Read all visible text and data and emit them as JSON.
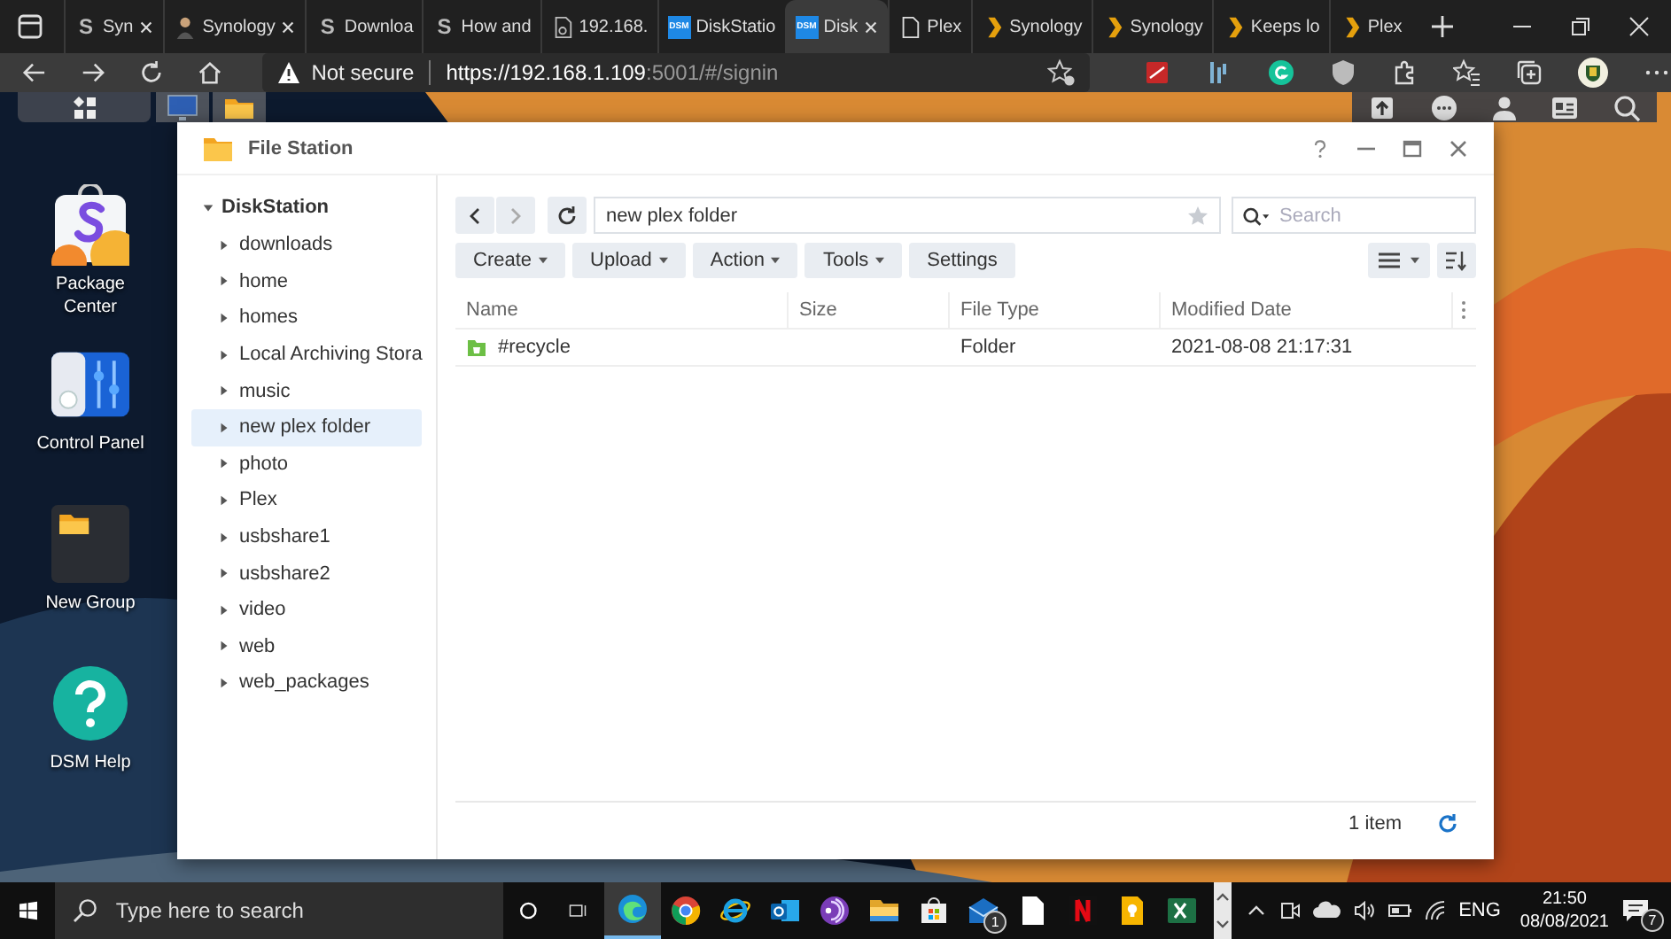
{
  "browser": {
    "tabs": [
      {
        "label": "Syn",
        "kind": "letter",
        "favicon_text": "S",
        "selected": false,
        "closable": true
      },
      {
        "label": "Synology",
        "kind": "person",
        "selected": false,
        "closable": true
      },
      {
        "label": "Downloa",
        "kind": "letter",
        "favicon_text": "S",
        "selected": false,
        "closable": false
      },
      {
        "label": "How and",
        "kind": "letter",
        "favicon_text": "S",
        "selected": false,
        "closable": false
      },
      {
        "label": "192.168.",
        "kind": "pagegear",
        "selected": false,
        "closable": false
      },
      {
        "label": "DiskStatio",
        "kind": "dsm",
        "favicon_text": "DSM",
        "selected": false,
        "closable": false
      },
      {
        "label": "Disk",
        "kind": "dsm",
        "favicon_text": "DSM",
        "selected": true,
        "closable": true
      },
      {
        "label": "Plex",
        "kind": "page",
        "selected": false,
        "closable": false
      },
      {
        "label": "Synology",
        "kind": "chevron",
        "selected": false,
        "closable": false
      },
      {
        "label": "Synology",
        "kind": "chevron",
        "selected": false,
        "closable": false
      },
      {
        "label": "Keeps lo",
        "kind": "chevron",
        "selected": false,
        "closable": false
      },
      {
        "label": "Plex",
        "kind": "chevron",
        "selected": false,
        "closable": false
      }
    ],
    "security": "Not secure",
    "url_main": "https://192.168.1.109",
    "url_rest": ":5001/#/signin"
  },
  "desktop": {
    "shortcuts": [
      {
        "kind": "package",
        "label": "Package Center"
      },
      {
        "kind": "control",
        "label": "Control Panel"
      },
      {
        "kind": "group",
        "label": "New Group"
      },
      {
        "kind": "help",
        "label": "DSM Help"
      }
    ]
  },
  "file_station": {
    "title": "File Station",
    "tree": {
      "label": "DiskStation",
      "expanded": true,
      "children": [
        {
          "label": "downloads",
          "expanded": false,
          "selected": false
        },
        {
          "label": "home",
          "expanded": false,
          "selected": false
        },
        {
          "label": "homes",
          "expanded": false,
          "selected": false
        },
        {
          "label": "Local Archiving Stora",
          "expanded": false,
          "selected": false
        },
        {
          "label": "music",
          "expanded": false,
          "selected": false
        },
        {
          "label": "new plex folder",
          "expanded": false,
          "selected": true
        },
        {
          "label": "photo",
          "expanded": false,
          "selected": false
        },
        {
          "label": "Plex",
          "expanded": false,
          "selected": false
        },
        {
          "label": "usbshare1",
          "expanded": false,
          "selected": false
        },
        {
          "label": "usbshare2",
          "expanded": false,
          "selected": false
        },
        {
          "label": "video",
          "expanded": false,
          "selected": false
        },
        {
          "label": "web",
          "expanded": false,
          "selected": false
        },
        {
          "label": "web_packages",
          "expanded": false,
          "selected": false
        }
      ]
    },
    "path": "new plex folder",
    "search_placeholder": "Search",
    "toolbar": [
      {
        "label": "Create",
        "dropdown": true
      },
      {
        "label": "Upload",
        "dropdown": true
      },
      {
        "label": "Action",
        "dropdown": true
      },
      {
        "label": "Tools",
        "dropdown": true
      },
      {
        "label": "Settings",
        "dropdown": false
      }
    ],
    "columns": [
      "Name",
      "Size",
      "File Type",
      "Modified Date"
    ],
    "rows": [
      {
        "name": "#recycle",
        "file_type": "Folder",
        "modified": "2021-08-08 21:17:31"
      }
    ],
    "item_count": "1 item"
  },
  "taskbar": {
    "search_placeholder": "Type here to search",
    "apps": [
      {
        "kind": "edge",
        "active": true
      },
      {
        "kind": "chrome",
        "active": false
      },
      {
        "kind": "ie",
        "active": false
      },
      {
        "kind": "outlook",
        "active": false
      },
      {
        "kind": "podcast",
        "active": false
      },
      {
        "kind": "explorer",
        "active": false
      },
      {
        "kind": "store",
        "active": false
      },
      {
        "kind": "mail",
        "active": false,
        "badge": "1"
      },
      {
        "kind": "document",
        "active": false
      },
      {
        "kind": "video",
        "active": false
      },
      {
        "kind": "keep",
        "active": false
      },
      {
        "kind": "excel",
        "active": false
      }
    ],
    "language": "ENG",
    "time": "21:50",
    "date": "08/08/2021",
    "notification_count": "7"
  }
}
